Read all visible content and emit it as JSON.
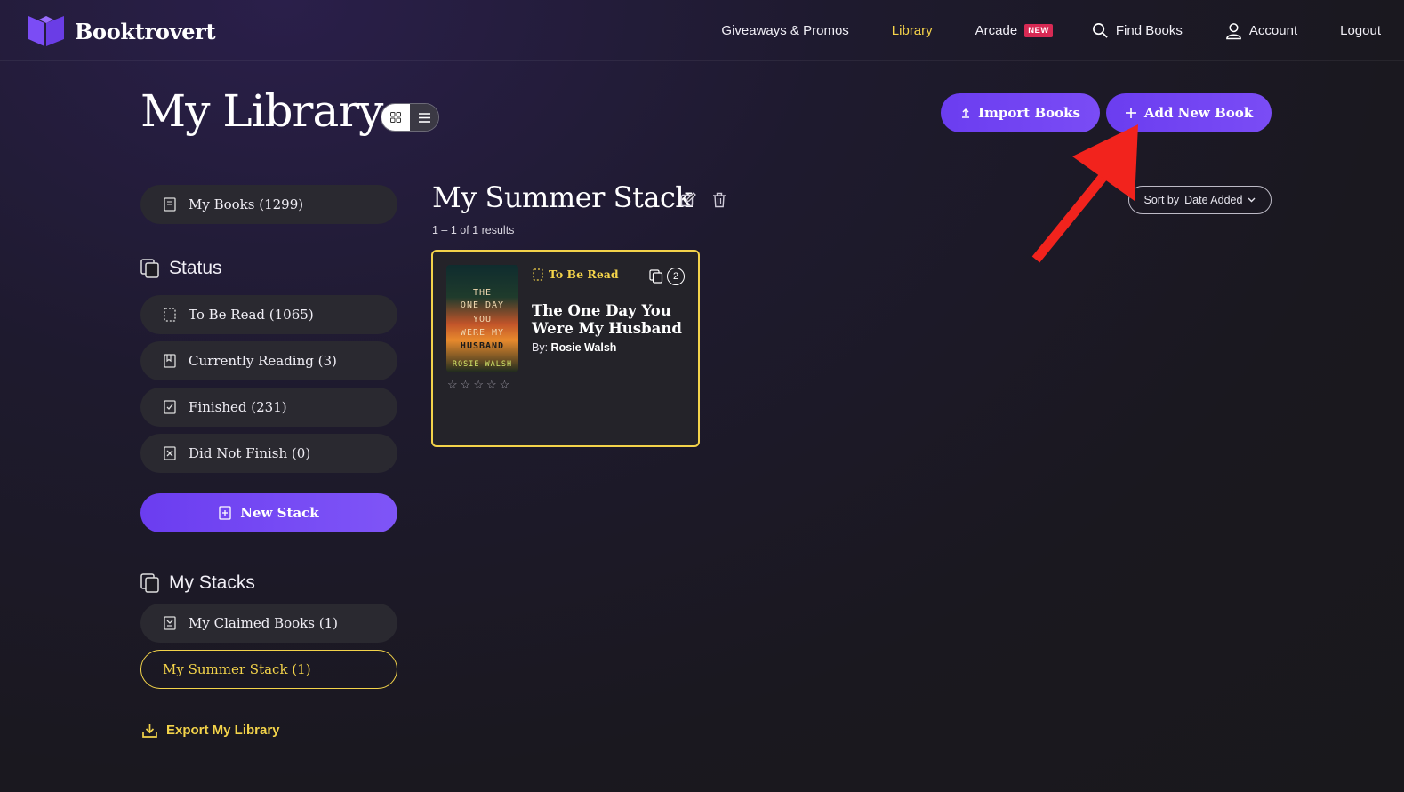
{
  "brand": {
    "name": "Booktrovert",
    "logo_color": "#7b4cf5"
  },
  "nav": {
    "items": [
      {
        "label": "Giveaways & Promos"
      },
      {
        "label": "Library",
        "active": true
      },
      {
        "label": "Arcade",
        "badge": "NEW"
      },
      {
        "label": "Find Books",
        "icon": "search-icon"
      },
      {
        "label": "Account",
        "icon": "user-icon"
      },
      {
        "label": "Logout"
      }
    ]
  },
  "page": {
    "title": "My Library"
  },
  "actions": {
    "import_label": "Import Books",
    "add_label": "Add New Book"
  },
  "sidebar": {
    "my_books": "My Books (1299)",
    "status_heading": "Status",
    "status_items": [
      {
        "label": "To Be Read (1065)",
        "icon": "dashed-book-icon"
      },
      {
        "label": "Currently Reading (3)",
        "icon": "bookmark-book-icon"
      },
      {
        "label": "Finished (231)",
        "icon": "check-book-icon"
      },
      {
        "label": "Did Not Finish (0)",
        "icon": "x-book-icon"
      }
    ],
    "new_stack_label": "New Stack",
    "stacks_heading": "My Stacks",
    "stacks": [
      {
        "label": "My Claimed Books (1)",
        "icon": "claimed-book-icon"
      },
      {
        "label": "My Summer Stack (1)",
        "selected": true
      }
    ],
    "export_label": "Export My Library"
  },
  "main": {
    "stack_title": "My Summer Stack",
    "results": "1 – 1 of 1 results",
    "sort_prefix": "Sort by",
    "sort_value": "Date Added",
    "book": {
      "status": "To Be Read",
      "stack_count": "2",
      "title": "The One Day You Were My Husband",
      "author_prefix": "By:",
      "author": "Rosie Walsh",
      "rating": 0,
      "cover_lines": [
        "THE",
        "ONE DAY",
        "YOU",
        "WERE MY",
        "HUSBAND",
        "ROSIE WALSH"
      ]
    }
  },
  "colors": {
    "accent": "#7b4cf5",
    "highlight": "#f3d34a",
    "annotation_arrow": "#f2231d"
  }
}
